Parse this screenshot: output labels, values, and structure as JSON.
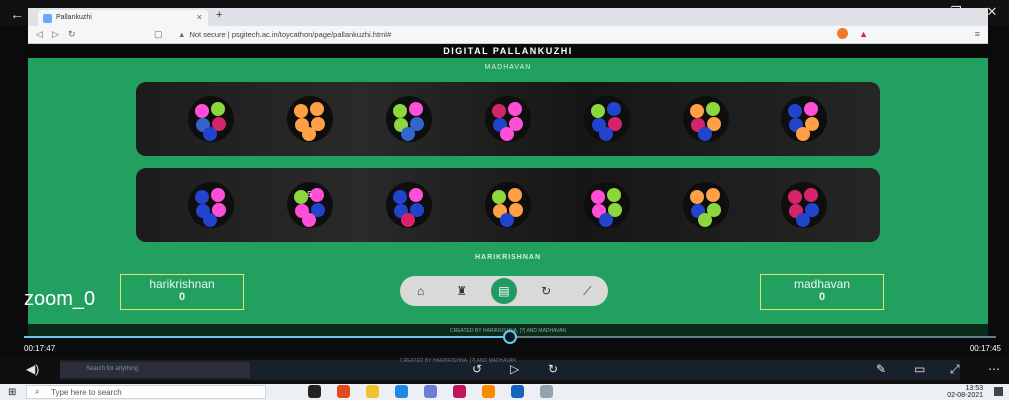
{
  "browser": {
    "tab_title": "Pallankuzhi",
    "url_warning": "Not secure",
    "url": "psgitech.ac.in/toycathon/page/pallankuzhi.html#"
  },
  "page": {
    "header": "DIGITAL PALLANKUZHI",
    "top_player_label": "MADHAVAN",
    "bottom_player_label": "HARIKRISHNAN",
    "pit_count_label": "5",
    "left_score": {
      "name": "harikrishnan",
      "value": "0"
    },
    "right_score": {
      "name": "madhavan",
      "value": "0"
    },
    "footer": "CREATED BY HARIKRISHNA, [?] AND MADHAVAN",
    "toolbar": [
      {
        "name": "home",
        "glyph": "⌂"
      },
      {
        "name": "rules",
        "glyph": "♜"
      },
      {
        "name": "save",
        "glyph": "▤"
      },
      {
        "name": "restart",
        "glyph": "↻"
      },
      {
        "name": "stats",
        "glyph": "⟋"
      }
    ]
  },
  "pits": {
    "top": [
      [
        "#ff4fd8",
        "#8cd83c",
        "#3366cc",
        "#d6246b",
        "#2244cc"
      ],
      [
        "#ffa046",
        "#ffa046",
        "#ffa046",
        "#ffa046",
        "#ffa046"
      ],
      [
        "#8cd83c",
        "#ff4fd8",
        "#8cd83c",
        "#3366cc",
        "#3366cc"
      ],
      [
        "#d6246b",
        "#ff4fd8",
        "#2244cc",
        "#ff4fd8",
        "#ff4fd8"
      ],
      [
        "#8cd83c",
        "#2244cc",
        "#2244cc",
        "#d6246b",
        "#2244cc"
      ],
      [
        "#ffa046",
        "#8cd83c",
        "#d6246b",
        "#ffa046",
        "#2244cc"
      ],
      [
        "#2244cc",
        "#ff4fd8",
        "#2244cc",
        "#ffa046",
        "#ffa046"
      ]
    ],
    "bottom": [
      [
        "#2244cc",
        "#ff4fd8",
        "#2244cc",
        "#ff4fd8",
        "#2244cc"
      ],
      [
        "#8cd83c",
        "#ff4fd8",
        "#ff4fd8",
        "#2244cc",
        "#ff4fd8"
      ],
      [
        "#2244cc",
        "#ff4fd8",
        "#2244cc",
        "#2244cc",
        "#d6246b"
      ],
      [
        "#8cd83c",
        "#ffa046",
        "#ffa046",
        "#ffa046",
        "#2244cc"
      ],
      [
        "#ff4fd8",
        "#8cd83c",
        "#ff4fd8",
        "#8cd83c",
        "#2244cc"
      ],
      [
        "#ffa046",
        "#ffa046",
        "#2244cc",
        "#8cd83c",
        "#8cd83c"
      ],
      [
        "#d6246b",
        "#d6246b",
        "#d6246b",
        "#2244cc",
        "#2244cc"
      ]
    ]
  },
  "video": {
    "overlay_label": "zoom_0",
    "time_current": "00:17:47",
    "time_total": "00:17:45",
    "progress_fraction": 0.5,
    "inner_search_placeholder": "Search for anything"
  },
  "taskbar": {
    "search_placeholder": "Type here to search",
    "time": "13:53",
    "date": "02-08-2021"
  },
  "colors": {
    "page_green": "#22a060",
    "accent_blue": "#6ac7f0"
  }
}
